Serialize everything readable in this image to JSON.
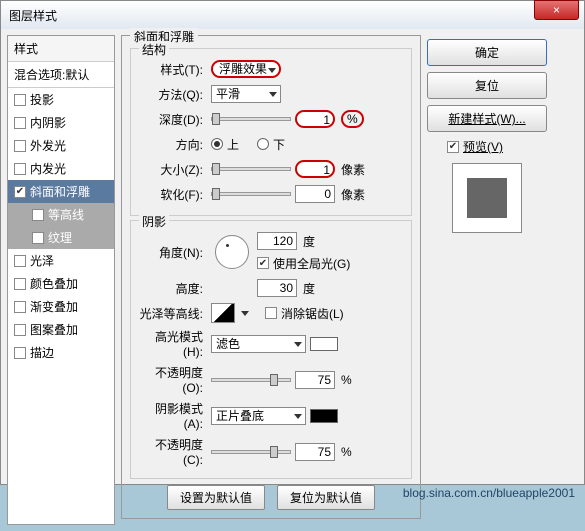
{
  "window": {
    "title": "图层样式",
    "close": "×"
  },
  "left": {
    "header": "样式",
    "blend": "混合选项:默认",
    "items": [
      {
        "label": "投影",
        "checked": false,
        "selected": false
      },
      {
        "label": "内阴影",
        "checked": false,
        "selected": false
      },
      {
        "label": "外发光",
        "checked": false,
        "selected": false
      },
      {
        "label": "内发光",
        "checked": false,
        "selected": false
      },
      {
        "label": "斜面和浮雕",
        "checked": true,
        "selected": true
      },
      {
        "label": "等高线",
        "checked": false,
        "sub": true
      },
      {
        "label": "纹理",
        "checked": false,
        "sub": true
      },
      {
        "label": "光泽",
        "checked": false,
        "selected": false
      },
      {
        "label": "颜色叠加",
        "checked": false,
        "selected": false
      },
      {
        "label": "渐变叠加",
        "checked": false,
        "selected": false
      },
      {
        "label": "图案叠加",
        "checked": false,
        "selected": false
      },
      {
        "label": "描边",
        "checked": false,
        "selected": false
      }
    ]
  },
  "main": {
    "title": "斜面和浮雕",
    "structure": {
      "title": "结构",
      "style_label": "样式(T):",
      "style_value": "浮雕效果",
      "method_label": "方法(Q):",
      "method_value": "平滑",
      "depth_label": "深度(D):",
      "depth_value": "1",
      "depth_unit": "%",
      "direction_label": "方向:",
      "dir_up": "上",
      "dir_down": "下",
      "size_label": "大小(Z):",
      "size_value": "1",
      "size_unit": "像素",
      "soften_label": "软化(F):",
      "soften_value": "0",
      "soften_unit": "像素"
    },
    "shading": {
      "title": "阴影",
      "angle_label": "角度(N):",
      "angle_value": "120",
      "angle_unit": "度",
      "global_label": "使用全局光(G)",
      "altitude_label": "高度:",
      "altitude_value": "30",
      "altitude_unit": "度",
      "gloss_label": "光泽等高线:",
      "antialias_label": "消除锯齿(L)",
      "highlight_label": "高光模式(H):",
      "highlight_value": "滤色",
      "highlight_opacity_label": "不透明度(O):",
      "highlight_opacity_value": "75",
      "highlight_opacity_unit": "%",
      "shadow_label": "阴影模式(A):",
      "shadow_value": "正片叠底",
      "shadow_opacity_label": "不透明度(C):",
      "shadow_opacity_value": "75",
      "shadow_opacity_unit": "%"
    },
    "defaults": {
      "set": "设置为默认值",
      "reset": "复位为默认值"
    }
  },
  "right": {
    "ok": "确定",
    "cancel": "复位",
    "new_style": "新建样式(W)...",
    "preview_label": "预览(V)"
  },
  "watermark": "blog.sina.com.cn/blueapple2001"
}
